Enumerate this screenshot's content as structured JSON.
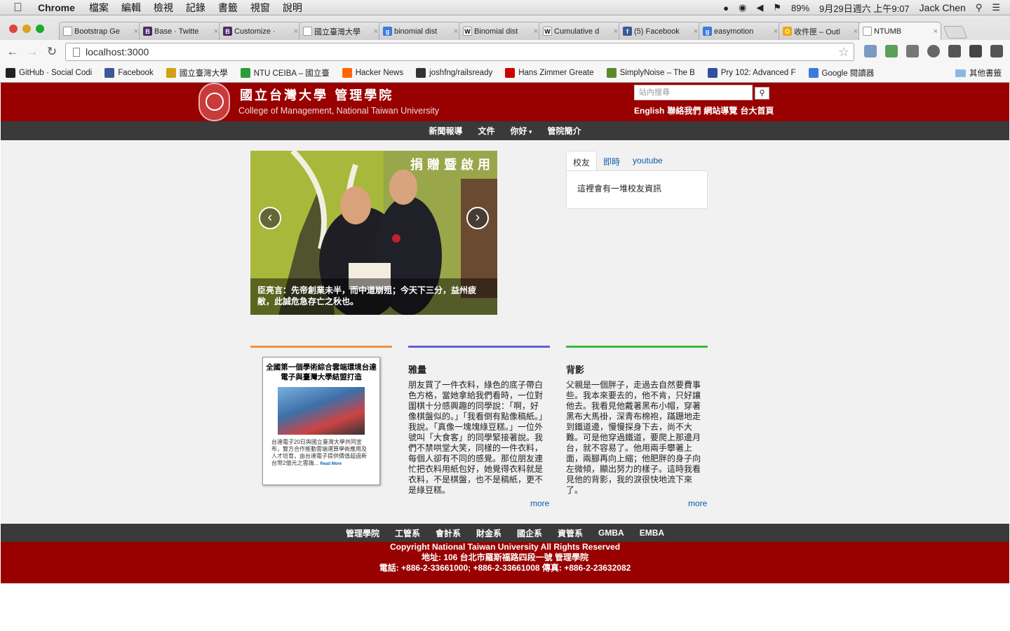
{
  "menubar": {
    "app": "Chrome",
    "items": [
      "檔案",
      "編輯",
      "檢視",
      "記錄",
      "書籤",
      "視窗",
      "說明"
    ],
    "battery": "89%",
    "datetime": "9月29日週六 上午9:07",
    "user": "Jack Chen"
  },
  "tabs": [
    {
      "title": "Bootstrap Ge",
      "color": "#ffffff",
      "fav": ""
    },
    {
      "title": "Base · Twitte",
      "color": "#4a2d6b",
      "fav": "B"
    },
    {
      "title": "Customize ·",
      "color": "#4a2d6b",
      "fav": "B"
    },
    {
      "title": "國立臺灣大學",
      "color": "#ffffff",
      "fav": ""
    },
    {
      "title": "binomial dist",
      "color": "#3a7be0",
      "fav": "g"
    },
    {
      "title": "Binomial dist",
      "color": "#ffffff",
      "fav": "W"
    },
    {
      "title": "Cumulative d",
      "color": "#ffffff",
      "fav": "W"
    },
    {
      "title": "(5) Facebook",
      "color": "#3b5998",
      "fav": "f"
    },
    {
      "title": "easymotion",
      "color": "#3a7be0",
      "fav": "g"
    },
    {
      "title": "收件匣 – Outl",
      "color": "#f0a800",
      "fav": "O"
    },
    {
      "title": "NTUMB",
      "color": "#ffffff",
      "fav": ""
    }
  ],
  "address": "localhost:3000",
  "bookmarks": [
    {
      "label": "GitHub · Social Codi",
      "color": "#222"
    },
    {
      "label": "Facebook",
      "color": "#3b5998"
    },
    {
      "label": "國立臺灣大學",
      "color": "#d4a017"
    },
    {
      "label": "NTU CEIBA – 國立臺",
      "color": "#2a9d3a"
    },
    {
      "label": "Hacker News",
      "color": "#ff6600"
    },
    {
      "label": "joshfng/railsready",
      "color": "#333"
    },
    {
      "label": "Hans Zimmer Greate",
      "color": "#cc0000"
    },
    {
      "label": "SimplyNoise – The B",
      "color": "#5a8a2a"
    },
    {
      "label": "Pry 102: Advanced F",
      "color": "#3050a0"
    },
    {
      "label": "Google 閱讀器",
      "color": "#3a7be0"
    }
  ],
  "bookmarks_other": "其他書籤",
  "site": {
    "title": "國立台灣大學 管理學院",
    "subtitle": "College of Management, National Taiwan University",
    "search_placeholder": "站內搜尋",
    "header_links": [
      "English",
      "聯絡我們",
      "網站導覽",
      "台大首頁"
    ],
    "nav": [
      "新聞報導",
      "文件",
      "你好",
      "管院簡介"
    ],
    "carousel_caption": "臣亮言：先帝創業未半，而中道崩殂；今天下三分，益州疲敝，此誠危急存亡之秋也。",
    "carousel_banner": "捐贈暨啟用",
    "side_tabs": [
      "校友",
      "即時",
      "youtube"
    ],
    "side_content": "這裡會有一堆校友資訊",
    "col1": {
      "card_title": "全國第一個學術綜合雲端環境台達電子與臺灣大學結盟打造",
      "card_text": "台達電子20日與國立臺灣大學共同宣布，雙方合作推動雲端運算學術應用及人才培育，由台達電子提供價值超過新台幣2億元之雲端...",
      "read_more": "Read More",
      "accent": "#f0943a"
    },
    "col2": {
      "heading": "雅量",
      "text": "朋友買了一件衣料，綠色的底子帶白色方格，當她拿給我們看時，一位對圍棋十分感興趣的同學說：「啊，好像棋盤似的。」「我看倒有點像稿紙。」我說。「真像一塊塊綠豆糕。」一位外號叫「大食客」的同學緊接著說。我們不禁哄堂大笑，同樣的一件衣料，每個人卻有不同的感覺。那位朋友連忙把衣料用紙包好，她覺得衣料就是衣料，不是棋盤，也不是稿紙，更不是綠豆糕。",
      "more": "more",
      "accent": "#5b5fe0"
    },
    "col3": {
      "heading": "背影",
      "text": "父親是一個胖子，走過去自然要費事些。我本來要去的，他不肯，只好讓他去。我看見他戴著黑布小帽，穿著黑布大馬褂，深青布棉袍，蹣跚地走到鐵道邊，慢慢探身下去，尚不大難。可是他穿過鐵道，要爬上那邊月台，就不容易了。他用兩手攀著上面，兩腳再向上縮；他肥胖的身子向左微傾，顯出努力的樣子。這時我看見他的背影，我的淚很快地流下來了。",
      "more": "more",
      "accent": "#3cb83c"
    },
    "footer_nav": [
      "管理學院",
      "工管系",
      "會計系",
      "財金系",
      "國企系",
      "資管系",
      "GMBA",
      "EMBA"
    ],
    "footer_lines": [
      "Copyright National Taiwan University All Rights Reserved",
      "地址: 106 台北市羅斯福路四段一號 管理學院",
      "電話: +886-2-33661000; +886-2-33661008 傳真: +886-2-23632082"
    ]
  }
}
